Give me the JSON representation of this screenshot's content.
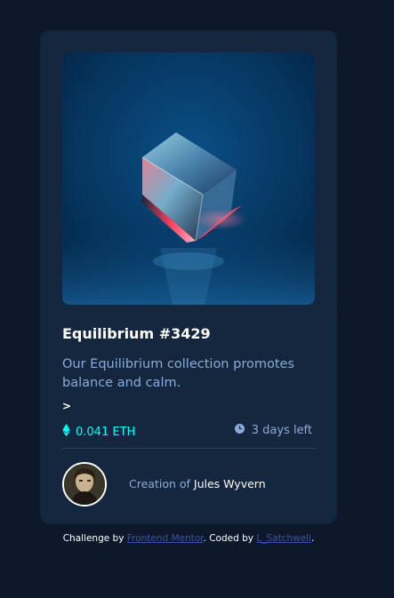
{
  "card": {
    "image_alt": "Equilibrium",
    "title": "Equilibrium #3429",
    "description": "Our Equilibrium collection promotes balance and calm.",
    "caret": ">",
    "price": {
      "icon": "ethereum-icon",
      "value": "0.041 ETH"
    },
    "time": {
      "icon": "clock-icon",
      "value": "3 days left"
    },
    "creator": {
      "prefix": "Creation of",
      "name": "Jules Wyvern"
    }
  },
  "attribution": {
    "challenge_text": "Challenge by",
    "frontend_mentor": "Frontend Mentor",
    "coded_text": ". Coded by",
    "coder": "L_Satchwell",
    "end": "."
  },
  "colors": {
    "page_background": "#0d192b",
    "card_background": "#15263f",
    "accent_cyan": "#00fff8",
    "soft_blue": "#8bacd9",
    "link_blue": "#3e52a3"
  }
}
